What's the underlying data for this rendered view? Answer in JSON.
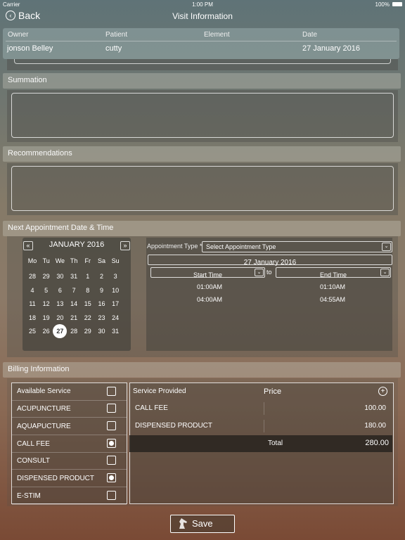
{
  "status_bar": {
    "carrier": "Carrier",
    "time": "1:00 PM",
    "battery": "100%"
  },
  "nav": {
    "back_label": "Back",
    "title": "Visit Information"
  },
  "visit_header": {
    "labels": [
      "Owner",
      "Patient",
      "Element",
      "Date"
    ],
    "values": [
      "jonson Belley",
      "cutty",
      "",
      "27 January 2016"
    ]
  },
  "sections": {
    "summation": "Summation",
    "recommendations": "Recommendations",
    "next_appointment": "Next Appointment Date & Time",
    "billing": "Billing Information"
  },
  "calendar": {
    "prev": "«",
    "next": "»",
    "month": "JANUARY 2016",
    "weekdays": [
      "Mo",
      "Tu",
      "We",
      "Th",
      "Fr",
      "Sa",
      "Su"
    ],
    "weeks": [
      [
        "28",
        "29",
        "30",
        "31",
        "1",
        "2",
        "3"
      ],
      [
        "4",
        "5",
        "6",
        "7",
        "8",
        "9",
        "10"
      ],
      [
        "11",
        "12",
        "13",
        "14",
        "15",
        "16",
        "17"
      ],
      [
        "18",
        "19",
        "20",
        "21",
        "22",
        "23",
        "24"
      ],
      [
        "25",
        "26",
        "27",
        "28",
        "29",
        "30",
        "31"
      ]
    ],
    "selected": "27"
  },
  "appointment": {
    "type_label": "Appointment Type *",
    "type_value": "Select Appointment Type",
    "date": "27 January 2016",
    "start_label": "Start Time",
    "to_label": "to",
    "end_label": "End Time",
    "start_times": [
      "01:00AM",
      "04:00AM"
    ],
    "end_times": [
      "01:10AM",
      "04:55AM"
    ]
  },
  "available_services": {
    "header": "Available Service",
    "items": [
      {
        "name": "ACUPUNCTURE",
        "checked": false
      },
      {
        "name": "AQUAPUCTURE",
        "checked": false
      },
      {
        "name": "CALL FEE",
        "checked": true
      },
      {
        "name": "CONSULT",
        "checked": false
      },
      {
        "name": "DISPENSED PRODUCT",
        "checked": true
      },
      {
        "name": "E-STIM",
        "checked": false
      }
    ]
  },
  "provided": {
    "header_service": "Service Provided",
    "header_price": "Price",
    "rows": [
      {
        "name": "CALL FEE",
        "price": "100.00"
      },
      {
        "name": "DISPENSED PRODUCT",
        "price": "180.00"
      }
    ],
    "total_label": "Total",
    "total_value": "280.00"
  },
  "save_label": "Save"
}
